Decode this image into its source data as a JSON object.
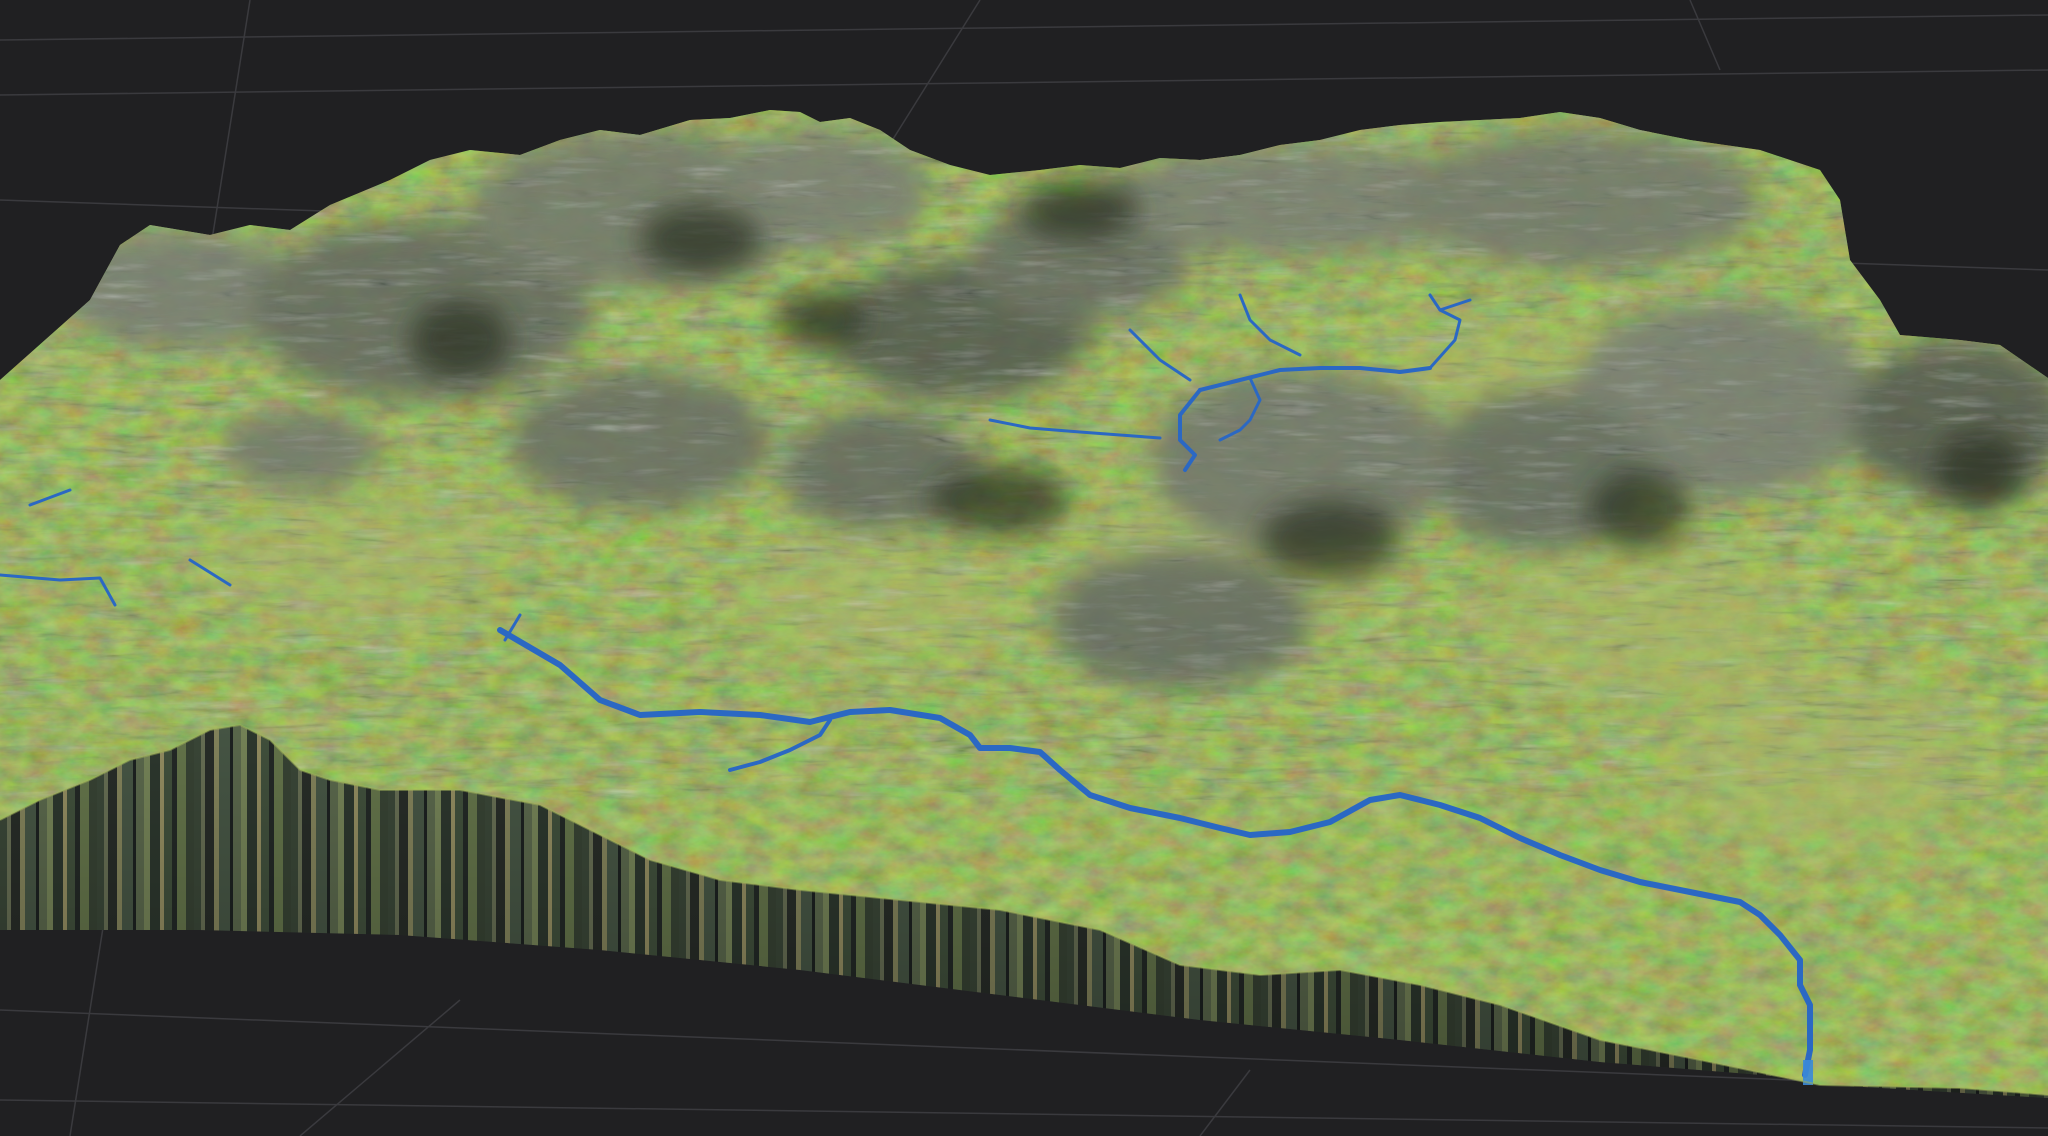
{
  "scene": {
    "background_color": "#202022",
    "grid_color": "#3a3a3e",
    "terrain_grass_color": "#6f8f34",
    "terrain_rock_color": "#7f847d",
    "terrain_shadow_color": "#33402a",
    "river_color": "#2e6fd0",
    "cliff_face_colors": [
      "#3d4a3a",
      "#6c7458",
      "#2a2f2a",
      "#4a5a48",
      "#8a8a60",
      "#1e2322",
      "#5f6d50"
    ]
  }
}
